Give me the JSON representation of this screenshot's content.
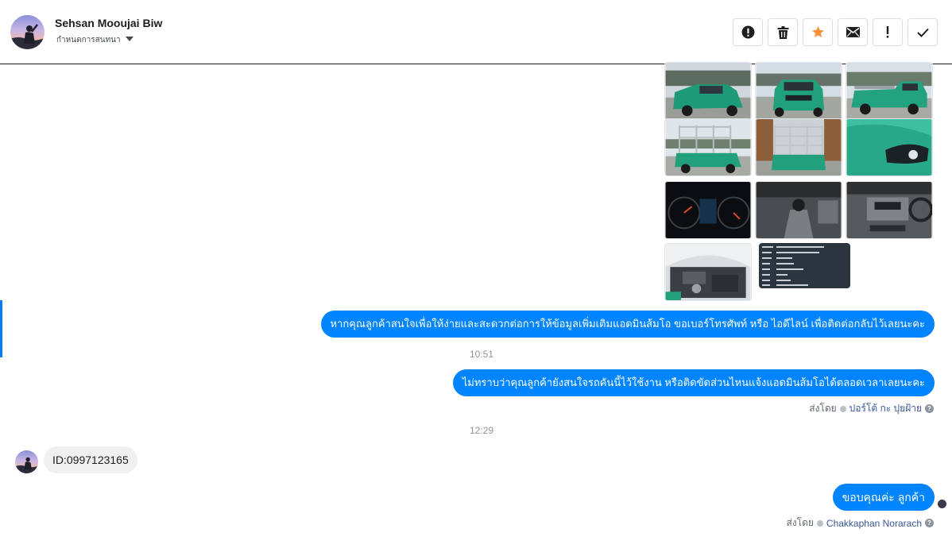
{
  "header": {
    "contact_name": "Sehsan Mooujai Biw",
    "status_label": "กำหนดการสนทนา"
  },
  "toolbar": {
    "buttons": [
      {
        "name": "mark-spam-button",
        "icon": "alert-circle-icon"
      },
      {
        "name": "delete-button",
        "icon": "trash-icon"
      },
      {
        "name": "star-button",
        "icon": "star-icon",
        "color": "#f7923b"
      },
      {
        "name": "mark-unread-button",
        "icon": "envelope-icon"
      },
      {
        "name": "mark-important-button",
        "icon": "exclamation-icon"
      },
      {
        "name": "mark-done-button",
        "icon": "check-icon"
      }
    ]
  },
  "photos": [
    {
      "name": "photo-truck-front-left",
      "kind": "truck"
    },
    {
      "name": "photo-truck-front",
      "kind": "truck"
    },
    {
      "name": "photo-truck-side",
      "kind": "truck"
    },
    {
      "name": "photo-truck-rear-left",
      "kind": "cage"
    },
    {
      "name": "photo-truck-rear",
      "kind": "cage"
    },
    {
      "name": "photo-headlight",
      "kind": "closeup"
    },
    {
      "name": "photo-dashboard",
      "kind": "dash"
    },
    {
      "name": "photo-gear-shift",
      "kind": "gear"
    },
    {
      "name": "photo-console",
      "kind": "console"
    },
    {
      "name": "photo-engine",
      "kind": "engine"
    },
    {
      "name": "photo-spec-card",
      "kind": "spec"
    }
  ],
  "messages": {
    "outgoing_1": "หากคุณลูกค้าสนใจเพื่อให้ง่ายและสะดวกต่อการให้ข้อมูลเพิ่มเติมแอดมินส้มโอ ขอเบอร์โทรศัพท์ หรือ ไอดีไลน์ เพื่อติดต่อกลับไว้เลยนะคะ",
    "time_1": "10:51",
    "outgoing_2": "ไม่ทราบว่าคุณลูกค้ายังสนใจรถคันนี้ไว้ใช้งาน หรือติดขัดส่วนไหนแจ้งแอดมินส้มโอได้ตลอดเวลาเลยนะคะ",
    "sent_by_label_1": "ส่งโดย",
    "sent_by_agent_1": "ปอร์โต้ กะ ปุยฝ้าย",
    "time_2": "12:29",
    "incoming_1": "ID:0997123165",
    "outgoing_3": "ขอบคุณค่ะ ลูกค้า",
    "sent_by_label_2": "ส่งโดย",
    "sent_by_agent_2": "Chakkaphan Norarach",
    "help_glyph": "?"
  },
  "colors": {
    "bubble_out": "#0084ff",
    "bubble_in": "#f0f0f0",
    "truck_green": "#2aa37a",
    "accent": "#0a7cff"
  }
}
